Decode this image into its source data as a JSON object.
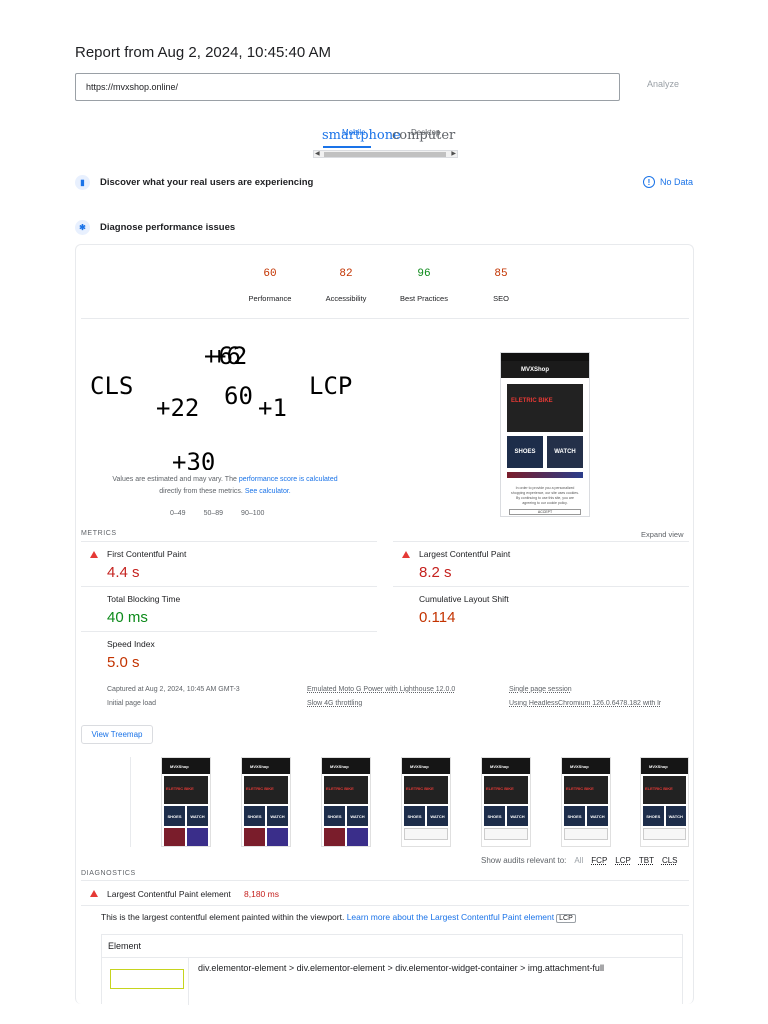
{
  "report": {
    "title": "Report from Aug 2, 2024, 10:45:40 AM",
    "url": "https://mvxshop.online/",
    "analyze_label": "Analyze"
  },
  "device_tabs": {
    "mobile_label": "smartphone",
    "mobile_small": "Mobile",
    "desktop_label": "computer",
    "desktop_small": "Desktop"
  },
  "sections": {
    "real_users": "Discover what your real users are experiencing",
    "no_data": "No Data",
    "diagnose": "Diagnose performance issues"
  },
  "categories": [
    {
      "score": "60",
      "label": "Performance",
      "status": "orange"
    },
    {
      "score": "82",
      "label": "Accessibility",
      "status": "orange"
    },
    {
      "score": "96",
      "label": "Best Practices",
      "status": "green"
    },
    {
      "score": "85",
      "label": "SEO",
      "status": "orange"
    }
  ],
  "perf_gauge": {
    "overlap_text": [
      "+62",
      "+6",
      "CLS",
      "+22",
      "60",
      "+1",
      "LCP",
      "+30"
    ]
  },
  "explain": {
    "prefix": "Values are estimated and may vary. The ",
    "link1": "performance score is calculated",
    "middle": " directly from these metrics. ",
    "link2": "See calculator."
  },
  "legend": [
    "0–49",
    "50–89",
    "90–100"
  ],
  "screenshot": {
    "brand": "MVXShop",
    "hero": "ELETRIC BIKE",
    "tile1": "SHOES",
    "tile2": "WATCH",
    "cookie": "In order to provide you a personalized shopping experience, our site uses cookies. By continuing to use this site, you are agreeing to our cookie policy.",
    "accept": "ACCEPT"
  },
  "metrics": {
    "label": "METRICS",
    "expand": "Expand view",
    "items": [
      {
        "name": "First Contentful Paint",
        "value": "4.4 s",
        "status": "red"
      },
      {
        "name": "Largest Contentful Paint",
        "value": "8.2 s",
        "status": "red"
      },
      {
        "name": "Total Blocking Time",
        "value": "40 ms",
        "status": "green"
      },
      {
        "name": "Cumulative Layout Shift",
        "value": "0.114",
        "status": "orange"
      },
      {
        "name": "Speed Index",
        "value": "5.0 s",
        "status": "orange"
      }
    ]
  },
  "run_info": {
    "captured": "Captured at Aug 2, 2024, 10:45 AM GMT-3",
    "initial": "Initial page load",
    "emulated": "Emulated Moto G Power with Lighthouse 12.0.0",
    "throttling": "Slow 4G throttling",
    "session": "Single page session",
    "browser": "Using HeadlessChromium 126.0.6478.182 with lr"
  },
  "treemap_label": "View Treemap",
  "filmstrip": {
    "brand": "MVXShop",
    "hero": "ELETRIC BIKE",
    "tile1": "SHOES",
    "tile2": "WATCH"
  },
  "show_audits": {
    "label": "Show audits relevant to:",
    "filters": [
      "All",
      "FCP",
      "LCP",
      "TBT",
      "CLS"
    ]
  },
  "diagnostics": {
    "label": "DIAGNOSTICS",
    "item_title": "Largest Contentful Paint element",
    "item_value": "8,180 ms",
    "desc_prefix": "This is the largest contentful element painted within the viewport. ",
    "desc_link": "Learn more about the Largest Contentful Paint element",
    "desc_badge": "LCP",
    "table_header": "Element",
    "element_path": "div.elementor-element > div.elementor-element > div.elementor-widget-container > img.attachment-full"
  }
}
